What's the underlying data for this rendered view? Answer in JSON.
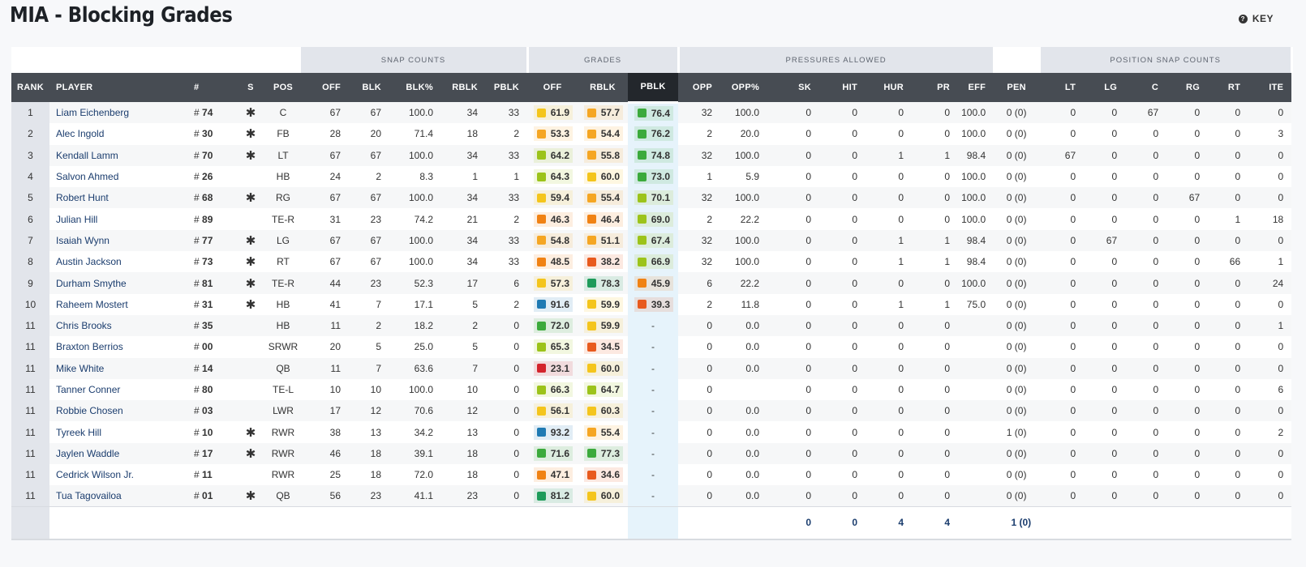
{
  "page": {
    "title": "MIA - Blocking Grades",
    "key_label": "KEY",
    "key_icon": "?"
  },
  "groups": {
    "snap_counts": "SNAP COUNTS",
    "grades": "GRADES",
    "pressures": "PRESSURES ALLOWED",
    "position_snaps": "POSITION SNAP COUNTS"
  },
  "columns": [
    "RANK",
    "PLAYER",
    "#",
    "S",
    "POS",
    "OFF",
    "BLK",
    "BLK%",
    "RBLK",
    "PBLK",
    "OFF",
    "RBLK",
    "PBLK",
    "OPP",
    "OPP%",
    "SK",
    "HIT",
    "HUR",
    "PR",
    "EFF",
    "PEN",
    "LT",
    "LG",
    "C",
    "RG",
    "RT",
    "ITE"
  ],
  "grade_colors": {
    "dark_green": "#1e9b5a",
    "green": "#3caa3c",
    "lime": "#9cc31a",
    "yellow": "#f4c51c",
    "amber": "#f5a623",
    "orange": "#f08214",
    "red_orange": "#e85a1e",
    "red": "#d3242c",
    "blue": "#1f7ab3"
  },
  "rows": [
    {
      "rank": "1",
      "player": "Liam Eichenberg",
      "num": "74",
      "s": "✱",
      "pos": "C",
      "off": "67",
      "blk": "67",
      "blkp": "100.0",
      "rblk": "34",
      "pblk": "33",
      "g_off": "61.9",
      "g_off_c": "yellow",
      "g_rblk": "57.7",
      "g_rblk_c": "amber",
      "g_pblk": "76.4",
      "g_pblk_c": "green",
      "opp": "32",
      "oppp": "100.0",
      "sk": "0",
      "hit": "0",
      "hur": "0",
      "pr": "0",
      "eff": "100.0",
      "pen": "0 (0)",
      "lt": "0",
      "lg": "0",
      "c": "67",
      "rg": "0",
      "rt": "0",
      "ite": "0"
    },
    {
      "rank": "2",
      "player": "Alec Ingold",
      "num": "30",
      "s": "✱",
      "pos": "FB",
      "off": "28",
      "blk": "20",
      "blkp": "71.4",
      "rblk": "18",
      "pblk": "2",
      "g_off": "53.3",
      "g_off_c": "amber",
      "g_rblk": "54.4",
      "g_rblk_c": "amber",
      "g_pblk": "76.2",
      "g_pblk_c": "green",
      "opp": "2",
      "oppp": "20.0",
      "sk": "0",
      "hit": "0",
      "hur": "0",
      "pr": "0",
      "eff": "100.0",
      "pen": "0 (0)",
      "lt": "0",
      "lg": "0",
      "c": "0",
      "rg": "0",
      "rt": "0",
      "ite": "3"
    },
    {
      "rank": "3",
      "player": "Kendall Lamm",
      "num": "70",
      "s": "✱",
      "pos": "LT",
      "off": "67",
      "blk": "67",
      "blkp": "100.0",
      "rblk": "34",
      "pblk": "33",
      "g_off": "64.2",
      "g_off_c": "lime",
      "g_rblk": "55.8",
      "g_rblk_c": "amber",
      "g_pblk": "74.8",
      "g_pblk_c": "green",
      "opp": "32",
      "oppp": "100.0",
      "sk": "0",
      "hit": "0",
      "hur": "1",
      "pr": "1",
      "eff": "98.4",
      "pen": "0 (0)",
      "lt": "67",
      "lg": "0",
      "c": "0",
      "rg": "0",
      "rt": "0",
      "ite": "0"
    },
    {
      "rank": "4",
      "player": "Salvon Ahmed",
      "num": "26",
      "s": "",
      "pos": "HB",
      "off": "24",
      "blk": "2",
      "blkp": "8.3",
      "rblk": "1",
      "pblk": "1",
      "g_off": "64.3",
      "g_off_c": "lime",
      "g_rblk": "60.0",
      "g_rblk_c": "yellow",
      "g_pblk": "73.0",
      "g_pblk_c": "green",
      "opp": "1",
      "oppp": "5.9",
      "sk": "0",
      "hit": "0",
      "hur": "0",
      "pr": "0",
      "eff": "100.0",
      "pen": "0 (0)",
      "lt": "0",
      "lg": "0",
      "c": "0",
      "rg": "0",
      "rt": "0",
      "ite": "0"
    },
    {
      "rank": "5",
      "player": "Robert Hunt",
      "num": "68",
      "s": "✱",
      "pos": "RG",
      "off": "67",
      "blk": "67",
      "blkp": "100.0",
      "rblk": "34",
      "pblk": "33",
      "g_off": "59.4",
      "g_off_c": "yellow",
      "g_rblk": "55.4",
      "g_rblk_c": "amber",
      "g_pblk": "70.1",
      "g_pblk_c": "lime",
      "opp": "32",
      "oppp": "100.0",
      "sk": "0",
      "hit": "0",
      "hur": "0",
      "pr": "0",
      "eff": "100.0",
      "pen": "0 (0)",
      "lt": "0",
      "lg": "0",
      "c": "0",
      "rg": "67",
      "rt": "0",
      "ite": "0"
    },
    {
      "rank": "6",
      "player": "Julian Hill",
      "num": "89",
      "s": "",
      "pos": "TE-R",
      "off": "31",
      "blk": "23",
      "blkp": "74.2",
      "rblk": "21",
      "pblk": "2",
      "g_off": "46.3",
      "g_off_c": "orange",
      "g_rblk": "46.4",
      "g_rblk_c": "orange",
      "g_pblk": "69.0",
      "g_pblk_c": "lime",
      "opp": "2",
      "oppp": "22.2",
      "sk": "0",
      "hit": "0",
      "hur": "0",
      "pr": "0",
      "eff": "100.0",
      "pen": "0 (0)",
      "lt": "0",
      "lg": "0",
      "c": "0",
      "rg": "0",
      "rt": "1",
      "ite": "18"
    },
    {
      "rank": "7",
      "player": "Isaiah Wynn",
      "num": "77",
      "s": "✱",
      "pos": "LG",
      "off": "67",
      "blk": "67",
      "blkp": "100.0",
      "rblk": "34",
      "pblk": "33",
      "g_off": "54.8",
      "g_off_c": "amber",
      "g_rblk": "51.1",
      "g_rblk_c": "amber",
      "g_pblk": "67.4",
      "g_pblk_c": "lime",
      "opp": "32",
      "oppp": "100.0",
      "sk": "0",
      "hit": "0",
      "hur": "1",
      "pr": "1",
      "eff": "98.4",
      "pen": "0 (0)",
      "lt": "0",
      "lg": "67",
      "c": "0",
      "rg": "0",
      "rt": "0",
      "ite": "0"
    },
    {
      "rank": "8",
      "player": "Austin Jackson",
      "num": "73",
      "s": "✱",
      "pos": "RT",
      "off": "67",
      "blk": "67",
      "blkp": "100.0",
      "rblk": "34",
      "pblk": "33",
      "g_off": "48.5",
      "g_off_c": "orange",
      "g_rblk": "38.2",
      "g_rblk_c": "red_orange",
      "g_pblk": "66.9",
      "g_pblk_c": "lime",
      "opp": "32",
      "oppp": "100.0",
      "sk": "0",
      "hit": "0",
      "hur": "1",
      "pr": "1",
      "eff": "98.4",
      "pen": "0 (0)",
      "lt": "0",
      "lg": "0",
      "c": "0",
      "rg": "0",
      "rt": "66",
      "ite": "1"
    },
    {
      "rank": "9",
      "player": "Durham Smythe",
      "num": "81",
      "s": "✱",
      "pos": "TE-R",
      "off": "44",
      "blk": "23",
      "blkp": "52.3",
      "rblk": "17",
      "pblk": "6",
      "g_off": "57.3",
      "g_off_c": "yellow",
      "g_rblk": "78.3",
      "g_rblk_c": "dark_green",
      "g_pblk": "45.9",
      "g_pblk_c": "orange",
      "opp": "6",
      "oppp": "22.2",
      "sk": "0",
      "hit": "0",
      "hur": "0",
      "pr": "0",
      "eff": "100.0",
      "pen": "0 (0)",
      "lt": "0",
      "lg": "0",
      "c": "0",
      "rg": "0",
      "rt": "0",
      "ite": "24"
    },
    {
      "rank": "10",
      "player": "Raheem Mostert",
      "num": "31",
      "s": "✱",
      "pos": "HB",
      "off": "41",
      "blk": "7",
      "blkp": "17.1",
      "rblk": "5",
      "pblk": "2",
      "g_off": "91.6",
      "g_off_c": "blue",
      "g_rblk": "59.9",
      "g_rblk_c": "yellow",
      "g_pblk": "39.3",
      "g_pblk_c": "red_orange",
      "opp": "2",
      "oppp": "11.8",
      "sk": "0",
      "hit": "0",
      "hur": "1",
      "pr": "1",
      "eff": "75.0",
      "pen": "0 (0)",
      "lt": "0",
      "lg": "0",
      "c": "0",
      "rg": "0",
      "rt": "0",
      "ite": "0"
    },
    {
      "rank": "11",
      "player": "Chris Brooks",
      "num": "35",
      "s": "",
      "pos": "HB",
      "off": "11",
      "blk": "2",
      "blkp": "18.2",
      "rblk": "2",
      "pblk": "0",
      "g_off": "72.0",
      "g_off_c": "green",
      "g_rblk": "59.9",
      "g_rblk_c": "yellow",
      "g_pblk": "-",
      "g_pblk_c": "",
      "opp": "0",
      "oppp": "0.0",
      "sk": "0",
      "hit": "0",
      "hur": "0",
      "pr": "0",
      "eff": "",
      "pen": "0 (0)",
      "lt": "0",
      "lg": "0",
      "c": "0",
      "rg": "0",
      "rt": "0",
      "ite": "1"
    },
    {
      "rank": "11",
      "player": "Braxton Berrios",
      "num": "00",
      "s": "",
      "pos": "SRWR",
      "off": "20",
      "blk": "5",
      "blkp": "25.0",
      "rblk": "5",
      "pblk": "0",
      "g_off": "65.3",
      "g_off_c": "lime",
      "g_rblk": "34.5",
      "g_rblk_c": "red_orange",
      "g_pblk": "-",
      "g_pblk_c": "",
      "opp": "0",
      "oppp": "0.0",
      "sk": "0",
      "hit": "0",
      "hur": "0",
      "pr": "0",
      "eff": "",
      "pen": "0 (0)",
      "lt": "0",
      "lg": "0",
      "c": "0",
      "rg": "0",
      "rt": "0",
      "ite": "0"
    },
    {
      "rank": "11",
      "player": "Mike White",
      "num": "14",
      "s": "",
      "pos": "QB",
      "off": "11",
      "blk": "7",
      "blkp": "63.6",
      "rblk": "7",
      "pblk": "0",
      "g_off": "23.1",
      "g_off_c": "red",
      "g_rblk": "60.0",
      "g_rblk_c": "yellow",
      "g_pblk": "-",
      "g_pblk_c": "",
      "opp": "0",
      "oppp": "0.0",
      "sk": "0",
      "hit": "0",
      "hur": "0",
      "pr": "0",
      "eff": "",
      "pen": "0 (0)",
      "lt": "0",
      "lg": "0",
      "c": "0",
      "rg": "0",
      "rt": "0",
      "ite": "0"
    },
    {
      "rank": "11",
      "player": "Tanner Conner",
      "num": "80",
      "s": "",
      "pos": "TE-L",
      "off": "10",
      "blk": "10",
      "blkp": "100.0",
      "rblk": "10",
      "pblk": "0",
      "g_off": "66.3",
      "g_off_c": "lime",
      "g_rblk": "64.7",
      "g_rblk_c": "lime",
      "g_pblk": "-",
      "g_pblk_c": "",
      "opp": "0",
      "oppp": "",
      "sk": "0",
      "hit": "0",
      "hur": "0",
      "pr": "0",
      "eff": "",
      "pen": "0 (0)",
      "lt": "0",
      "lg": "0",
      "c": "0",
      "rg": "0",
      "rt": "0",
      "ite": "6"
    },
    {
      "rank": "11",
      "player": "Robbie Chosen",
      "num": "03",
      "s": "",
      "pos": "LWR",
      "off": "17",
      "blk": "12",
      "blkp": "70.6",
      "rblk": "12",
      "pblk": "0",
      "g_off": "56.1",
      "g_off_c": "yellow",
      "g_rblk": "60.3",
      "g_rblk_c": "yellow",
      "g_pblk": "-",
      "g_pblk_c": "",
      "opp": "0",
      "oppp": "0.0",
      "sk": "0",
      "hit": "0",
      "hur": "0",
      "pr": "0",
      "eff": "",
      "pen": "0 (0)",
      "lt": "0",
      "lg": "0",
      "c": "0",
      "rg": "0",
      "rt": "0",
      "ite": "0"
    },
    {
      "rank": "11",
      "player": "Tyreek Hill",
      "num": "10",
      "s": "✱",
      "pos": "RWR",
      "off": "38",
      "blk": "13",
      "blkp": "34.2",
      "rblk": "13",
      "pblk": "0",
      "g_off": "93.2",
      "g_off_c": "blue",
      "g_rblk": "55.4",
      "g_rblk_c": "amber",
      "g_pblk": "-",
      "g_pblk_c": "",
      "opp": "0",
      "oppp": "0.0",
      "sk": "0",
      "hit": "0",
      "hur": "0",
      "pr": "0",
      "eff": "",
      "pen": "1 (0)",
      "lt": "0",
      "lg": "0",
      "c": "0",
      "rg": "0",
      "rt": "0",
      "ite": "2"
    },
    {
      "rank": "11",
      "player": "Jaylen Waddle",
      "num": "17",
      "s": "✱",
      "pos": "RWR",
      "off": "46",
      "blk": "18",
      "blkp": "39.1",
      "rblk": "18",
      "pblk": "0",
      "g_off": "71.6",
      "g_off_c": "green",
      "g_rblk": "77.3",
      "g_rblk_c": "green",
      "g_pblk": "-",
      "g_pblk_c": "",
      "opp": "0",
      "oppp": "0.0",
      "sk": "0",
      "hit": "0",
      "hur": "0",
      "pr": "0",
      "eff": "",
      "pen": "0 (0)",
      "lt": "0",
      "lg": "0",
      "c": "0",
      "rg": "0",
      "rt": "0",
      "ite": "0"
    },
    {
      "rank": "11",
      "player": "Cedrick Wilson Jr.",
      "num": "11",
      "s": "",
      "pos": "RWR",
      "off": "25",
      "blk": "18",
      "blkp": "72.0",
      "rblk": "18",
      "pblk": "0",
      "g_off": "47.1",
      "g_off_c": "orange",
      "g_rblk": "34.6",
      "g_rblk_c": "red_orange",
      "g_pblk": "-",
      "g_pblk_c": "",
      "opp": "0",
      "oppp": "0.0",
      "sk": "0",
      "hit": "0",
      "hur": "0",
      "pr": "0",
      "eff": "",
      "pen": "0 (0)",
      "lt": "0",
      "lg": "0",
      "c": "0",
      "rg": "0",
      "rt": "0",
      "ite": "0"
    },
    {
      "rank": "11",
      "player": "Tua Tagovailoa",
      "num": "01",
      "s": "✱",
      "pos": "QB",
      "off": "56",
      "blk": "23",
      "blkp": "41.1",
      "rblk": "23",
      "pblk": "0",
      "g_off": "81.2",
      "g_off_c": "dark_green",
      "g_rblk": "60.0",
      "g_rblk_c": "yellow",
      "g_pblk": "-",
      "g_pblk_c": "",
      "opp": "0",
      "oppp": "0.0",
      "sk": "0",
      "hit": "0",
      "hur": "0",
      "pr": "0",
      "eff": "",
      "pen": "0 (0)",
      "lt": "0",
      "lg": "0",
      "c": "0",
      "rg": "0",
      "rt": "0",
      "ite": "0"
    }
  ],
  "totals": {
    "sk": "0",
    "hit": "0",
    "hur": "4",
    "pr": "4",
    "pen": "1 (0)"
  }
}
